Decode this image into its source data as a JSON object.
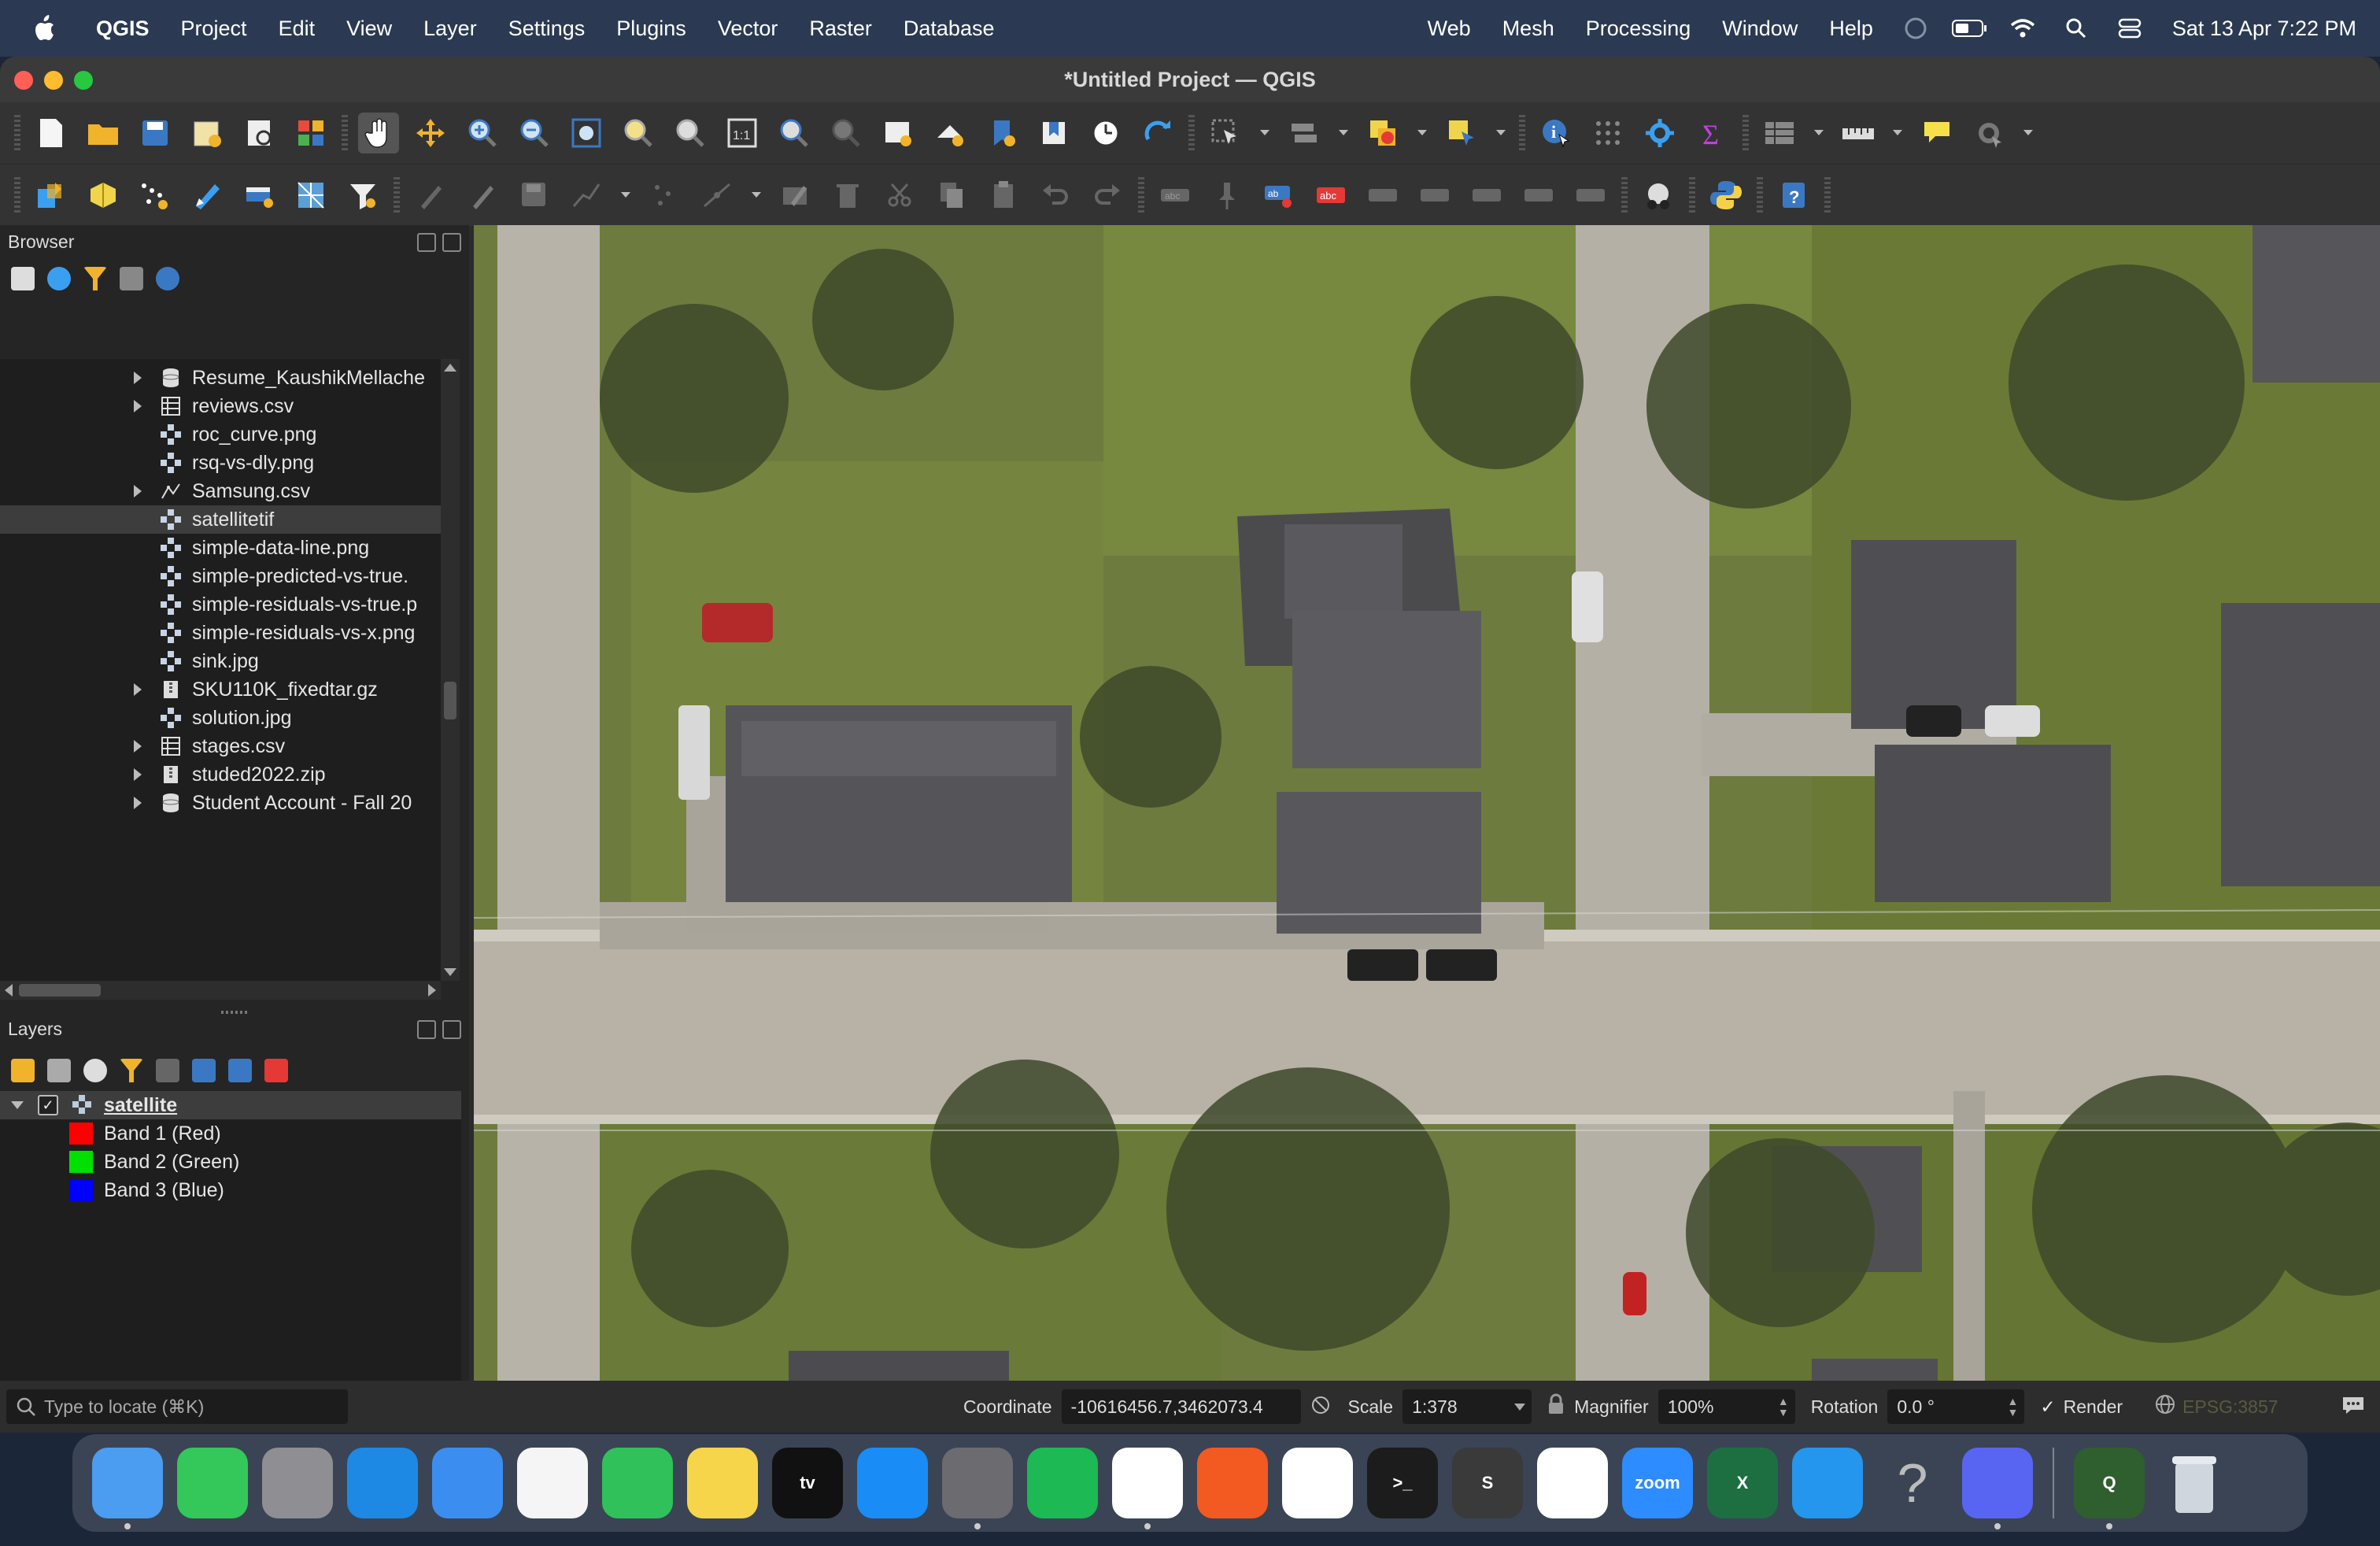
{
  "menubar": {
    "app_name": "QGIS",
    "items": [
      "Project",
      "Edit",
      "View",
      "Layer",
      "Settings",
      "Plugins",
      "Vector",
      "Raster",
      "Database"
    ],
    "right_items": [
      "Web",
      "Mesh",
      "Processing",
      "Window",
      "Help"
    ],
    "clock": "Sat 13 Apr  7:22 PM"
  },
  "window": {
    "title": "*Untitled Project — QGIS"
  },
  "browser": {
    "title": "Browser",
    "items": [
      {
        "name": "Resume_KaushikMellache",
        "type": "db",
        "expandable": true
      },
      {
        "name": "reviews.csv",
        "type": "table",
        "expandable": true
      },
      {
        "name": "roc_curve.png",
        "type": "raster",
        "expandable": false
      },
      {
        "name": "rsq-vs-dly.png",
        "type": "raster",
        "expandable": false
      },
      {
        "name": "Samsung.csv",
        "type": "vector",
        "expandable": true
      },
      {
        "name": "satellitetif",
        "type": "raster",
        "expandable": false,
        "selected": true
      },
      {
        "name": "simple-data-line.png",
        "type": "raster",
        "expandable": false
      },
      {
        "name": "simple-predicted-vs-true.",
        "type": "raster",
        "expandable": false
      },
      {
        "name": "simple-residuals-vs-true.p",
        "type": "raster",
        "expandable": false
      },
      {
        "name": "simple-residuals-vs-x.png",
        "type": "raster",
        "expandable": false
      },
      {
        "name": "sink.jpg",
        "type": "raster",
        "expandable": false
      },
      {
        "name": "SKU110K_fixedtar.gz",
        "type": "archive",
        "expandable": true
      },
      {
        "name": "solution.jpg",
        "type": "raster",
        "expandable": false
      },
      {
        "name": "stages.csv",
        "type": "table",
        "expandable": true
      },
      {
        "name": "studed2022.zip",
        "type": "archive",
        "expandable": true
      },
      {
        "name": "Student Account - Fall 20",
        "type": "db",
        "expandable": true
      }
    ]
  },
  "layers": {
    "title": "Layers",
    "layer_name": "satellite",
    "bands": [
      {
        "label": "Band 1 (Red)",
        "color": "#ff0000"
      },
      {
        "label": "Band 2 (Green)",
        "color": "#00e000"
      },
      {
        "label": "Band 3 (Blue)",
        "color": "#0000ff"
      }
    ]
  },
  "statusbar": {
    "locator_placeholder": "Type to locate (⌘K)",
    "coordinate_label": "Coordinate",
    "coordinate_value": "-10616456.7,3462073.4",
    "scale_label": "Scale",
    "scale_value": "1:378",
    "magnifier_label": "Magnifier",
    "magnifier_value": "100%",
    "rotation_label": "Rotation",
    "rotation_value": "0.0 °",
    "render_label": "Render",
    "crs": "EPSG:3857"
  },
  "dock": {
    "apps": [
      {
        "name": "finder-icon",
        "color": "#4a9df0",
        "glyph": "",
        "running": true
      },
      {
        "name": "messages-icon",
        "color": "#34c759",
        "glyph": "",
        "running": false
      },
      {
        "name": "launchpad-icon",
        "color": "#8e8e93",
        "glyph": "",
        "running": false
      },
      {
        "name": "safari-icon",
        "color": "#1e88e5",
        "glyph": "",
        "running": false
      },
      {
        "name": "mail-icon",
        "color": "#3b8ef0",
        "glyph": "",
        "running": false
      },
      {
        "name": "photos-icon",
        "color": "#f5f5f5",
        "glyph": "",
        "running": false
      },
      {
        "name": "facetime-icon",
        "color": "#30c15a",
        "glyph": "",
        "running": false
      },
      {
        "name": "notes-icon",
        "color": "#f7d54a",
        "glyph": "",
        "running": false
      },
      {
        "name": "appletv-icon",
        "color": "#111111",
        "glyph": "tv",
        "running": false
      },
      {
        "name": "appstore-icon",
        "color": "#1a8cf5",
        "glyph": "",
        "running": false
      },
      {
        "name": "system-settings-icon",
        "color": "#6b6b70",
        "glyph": "",
        "running": true
      },
      {
        "name": "spotify-icon",
        "color": "#1db954",
        "glyph": "",
        "running": false
      },
      {
        "name": "chrome-icon",
        "color": "#ffffff",
        "glyph": "",
        "running": true
      },
      {
        "name": "brave-icon",
        "color": "#f25a22",
        "glyph": "",
        "running": false
      },
      {
        "name": "slack-icon",
        "color": "#ffffff",
        "glyph": "",
        "running": false
      },
      {
        "name": "terminal-icon",
        "color": "#1c1c1c",
        "glyph": ">_",
        "running": false
      },
      {
        "name": "sublime-icon",
        "color": "#3a3a3a",
        "glyph": "S",
        "running": false
      },
      {
        "name": "vscode-icon",
        "color": "#ffffff",
        "glyph": "",
        "running": false
      },
      {
        "name": "zoom-icon",
        "color": "#2d8cff",
        "glyph": "zoom",
        "running": false
      },
      {
        "name": "excel-icon",
        "color": "#1d6f42",
        "glyph": "X",
        "running": false
      },
      {
        "name": "docker-icon",
        "color": "#2496ed",
        "glyph": "",
        "running": false
      },
      {
        "name": "help-icon",
        "color": "transparent",
        "glyph": "?",
        "running": false
      },
      {
        "name": "discord-icon",
        "color": "#5865f2",
        "glyph": "",
        "running": true
      }
    ],
    "pinned_right": [
      {
        "name": "qgis-icon",
        "color": "#2f5e2f",
        "glyph": "Q",
        "running": true
      },
      {
        "name": "trash-icon",
        "color": "transparent",
        "glyph": "",
        "running": false
      }
    ]
  }
}
